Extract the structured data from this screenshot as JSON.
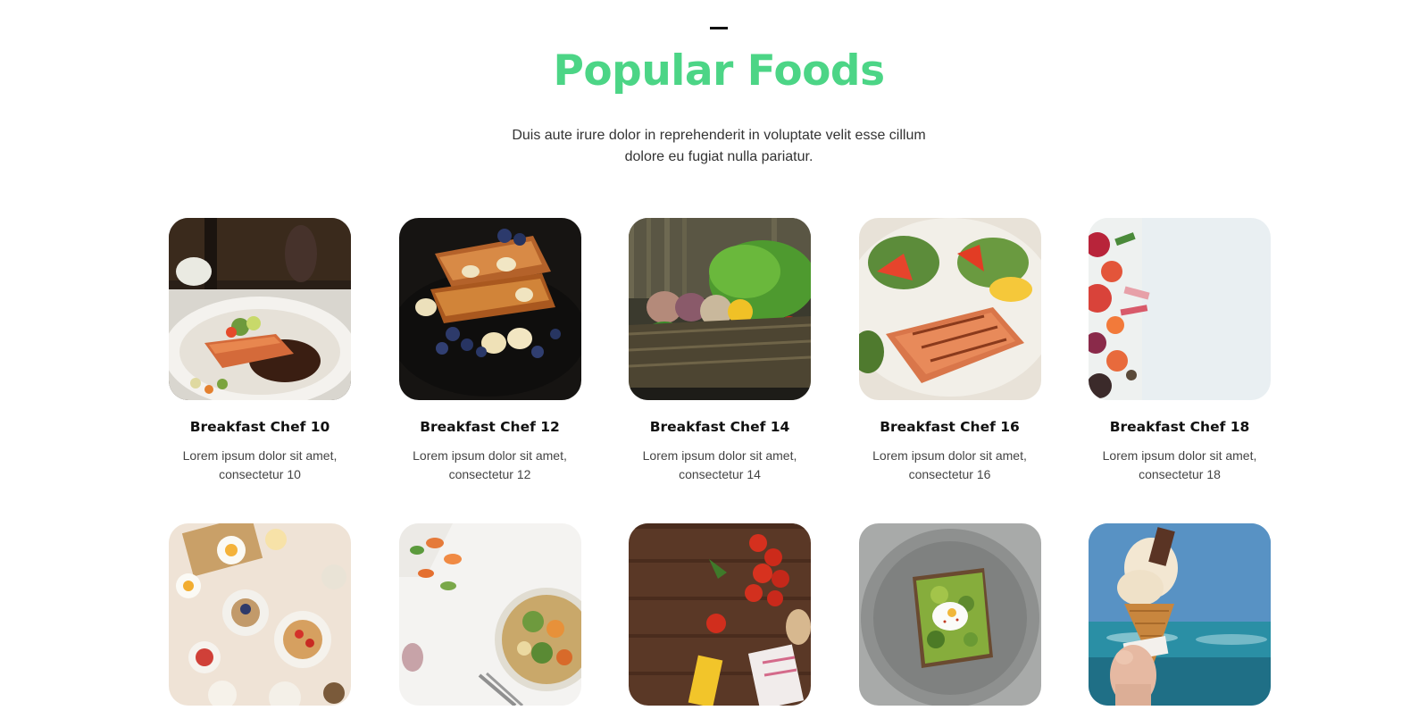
{
  "section": {
    "title": "Popular Foods",
    "subtitle": "Duis aute irure dolor in reprehenderit in voluptate velit esse cillum dolore eu fugiat nulla pariatur.",
    "accent_color": "#4cd586"
  },
  "foods": [
    {
      "title": "Breakfast Chef 10",
      "desc": "Lorem ipsum dolor sit amet, consectetur 10",
      "image": "salmon-plate-photo"
    },
    {
      "title": "Breakfast Chef 12",
      "desc": "Lorem ipsum dolor sit amet, consectetur 12",
      "image": "french-toast-photo"
    },
    {
      "title": "Breakfast Chef 14",
      "desc": "Lorem ipsum dolor sit amet, consectetur 14",
      "image": "vegetable-basket-photo"
    },
    {
      "title": "Breakfast Chef 16",
      "desc": "Lorem ipsum dolor sit amet, consectetur 16",
      "image": "grilled-salmon-salad-photo"
    },
    {
      "title": "Breakfast Chef 18",
      "desc": "Lorem ipsum dolor sit amet, consectetur 18",
      "image": "fruit-flatlay-photo"
    },
    {
      "title": "",
      "desc": "",
      "image": "brunch-table-photo"
    },
    {
      "title": "",
      "desc": "",
      "image": "grain-bowl-photo"
    },
    {
      "title": "",
      "desc": "",
      "image": "tomatoes-pasta-board-photo"
    },
    {
      "title": "",
      "desc": "",
      "image": "avocado-toast-photo"
    },
    {
      "title": "",
      "desc": "",
      "image": "ice-cream-cone-photo"
    }
  ]
}
